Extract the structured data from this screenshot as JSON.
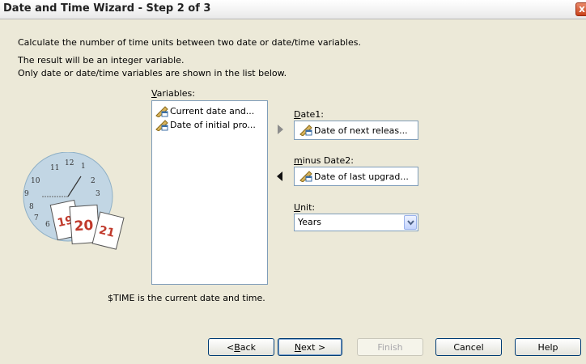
{
  "window": {
    "title": "Date and Time Wizard - Step 2 of 3",
    "close_label": "x"
  },
  "description": {
    "line1": "Calculate the number of time units between two date or date/time variables.",
    "line2": "The result will be an integer variable.",
    "line3": "Only date or date/time variables are shown in the list below."
  },
  "variables": {
    "label_hotkey": "V",
    "label_rest": "ariables:",
    "items": [
      {
        "label": "Current date and...",
        "icon": "date-variable-icon"
      },
      {
        "label": "Date of initial pro...",
        "icon": "date-variable-icon"
      }
    ]
  },
  "date1": {
    "label_hotkey": "D",
    "label_rest": "ate1:",
    "value": "Date of next releas..."
  },
  "date2": {
    "label_hotkey": "m",
    "label_rest": "inus Date2:",
    "value": "Date of last upgrad..."
  },
  "unit": {
    "label_hotkey": "U",
    "label_rest": "nit:",
    "value": "Years"
  },
  "illustration": {
    "clock_numbers": [
      "11",
      "12",
      "1",
      "10",
      "2",
      "9",
      "3",
      "8",
      "7",
      "6"
    ],
    "calendar_pages": [
      "19",
      "20",
      "21"
    ]
  },
  "note": "$TIME is the current date and time.",
  "buttons": {
    "back": {
      "prefix": "< ",
      "hotkey": "B",
      "rest": "ack"
    },
    "next": {
      "hotkey": "N",
      "rest": "ext >"
    },
    "finish": "Finish",
    "cancel": "Cancel",
    "help": "Help"
  },
  "colors": {
    "accent": "#003c74",
    "list_border": "#7f9db9",
    "dialog_bg": "#ece9d8"
  }
}
